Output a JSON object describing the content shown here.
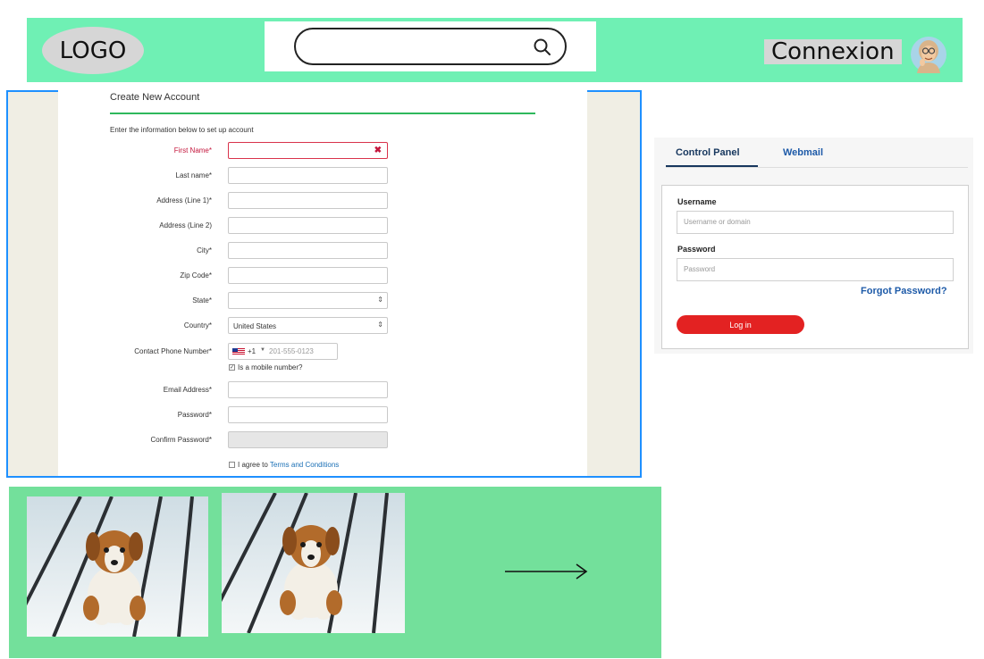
{
  "header": {
    "logo_text": "LOGO",
    "search_placeholder": "",
    "connexion_label": "Connexion",
    "colors": {
      "background": "#6ff0b4",
      "logo_bg": "#d6d6d6"
    }
  },
  "signup_form": {
    "title": "Create New Account",
    "intro": "Enter the information below to set up account",
    "first_name_label": "First Name*",
    "last_name_label": "Last name*",
    "address1_label": "Address (Line 1)*",
    "address2_label": "Address (Line 2)",
    "city_label": "City*",
    "zip_label": "Zip Code*",
    "state_label": "State*",
    "state_value": "",
    "country_label": "Country*",
    "country_value": "United States",
    "phone_label": "Contact Phone Number*",
    "phone_code": "+1",
    "phone_placeholder": "201-555-0123",
    "mobile_label": "Is a mobile number?",
    "mobile_checked": true,
    "email_label": "Email Address*",
    "password_label": "Password*",
    "confirm_password_label": "Confirm Password*",
    "agree_prefix": "I agree to ",
    "terms_link": "Terms and Conditions",
    "colors": {
      "error": "#c4163c",
      "rule": "#2eb85c",
      "frame": "#1e90ff",
      "link": "#1a6fb5"
    }
  },
  "login_panel": {
    "tab_control_panel": "Control Panel",
    "tab_webmail": "Webmail",
    "username_label": "Username",
    "username_placeholder": "Username or domain",
    "password_label": "Password",
    "password_placeholder": "Password",
    "forgot_label": "Forgot Password?",
    "login_button": "Log in",
    "colors": {
      "button": "#e32222",
      "tab_active": "#17375e",
      "link": "#1d5aa8"
    }
  },
  "gallery": {
    "background": "#73e09b",
    "photos": [
      "puppy-photo",
      "puppy-photo"
    ],
    "arrow_icon": "arrow-right-icon"
  }
}
